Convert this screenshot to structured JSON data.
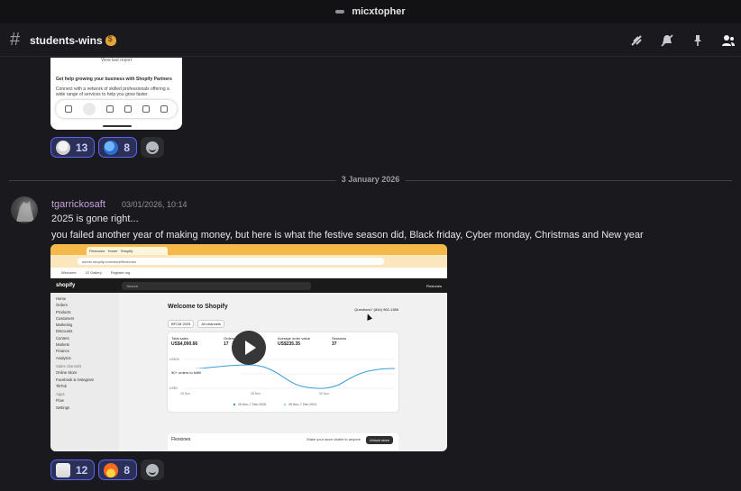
{
  "window": {
    "user": "micxtopher"
  },
  "channel": {
    "name": "students-wins",
    "toolbar_icons": [
      "threads-icon",
      "mute-icon",
      "pin-icon",
      "members-icon"
    ]
  },
  "colors": {
    "accent": "#5865f2",
    "author": "#c6a0dc",
    "background": "#1a1a1e"
  },
  "prev_message": {
    "screenshot_text": {
      "top": "View last report",
      "title": "Get help growing your business with Shopify Partners",
      "body": "Connect with a network of skilled professionals offering a wide range of services to help you grow faster."
    },
    "reactions": [
      {
        "emoji": "skull",
        "count": "13"
      },
      {
        "emoji": "globe",
        "count": "8"
      }
    ]
  },
  "date_divider": "3 January 2026",
  "message": {
    "author": "tgarrickosaft",
    "timestamp": "03/01/2026, 10:14",
    "line1": "2025 is gone right...",
    "line2": "you failed another year of making money, but here is what the festive season did, Black friday, Cyber monday, Christmas and New year",
    "video": {
      "tab_title": "Flexiones · Home · Shopify",
      "url": "admin.shopify.com/store/flexiones",
      "bookmarks": [
        "Welcome",
        "22 Gallery",
        "Register.org"
      ],
      "shop_logo": "shopify",
      "search": "Search",
      "store": "Flexiones",
      "nav": [
        "Home",
        "Orders",
        "Products",
        "Customers",
        "Marketing",
        "Discounts",
        "Content",
        "Markets",
        "Finance",
        "Analytics"
      ],
      "sales_channels_header": "Sales channels",
      "sales_channels": [
        "Online Store",
        "Facebook & Instagram",
        "TikTok"
      ],
      "apps_header": "Apps",
      "apps": [
        "Flow"
      ],
      "settings": "Settings",
      "welcome": "Welcome to Shopify",
      "questions": "Questions? (844) 962-1366",
      "chips": [
        "BFCM 2025",
        "All channels"
      ],
      "metrics": [
        {
          "label": "Total sales",
          "value": "US$4,090.66"
        },
        {
          "label": "Orders",
          "value": "17"
        },
        {
          "label": "Average order value",
          "value": "US$235.35"
        },
        {
          "label": "Sessions",
          "value": "37"
        }
      ],
      "y_ticks": [
        "US$2K",
        "US$1K",
        "US$0"
      ],
      "x_ticks": [
        "26 Nov",
        "28 Nov",
        "30 Nov"
      ],
      "legend": [
        "26 Nov–7 Dec 2025",
        "26 Nov–7 Dec 2024"
      ],
      "orders_to_fulfill": "50+ orders to fulfill",
      "store_footer": "Flexiones",
      "visibility_hint": "Make your store visible to anyone",
      "unlock_button": "Unlock store"
    },
    "reactions": [
      {
        "emoji": "goat",
        "count": "12"
      },
      {
        "emoji": "fire",
        "count": "8"
      }
    ]
  }
}
